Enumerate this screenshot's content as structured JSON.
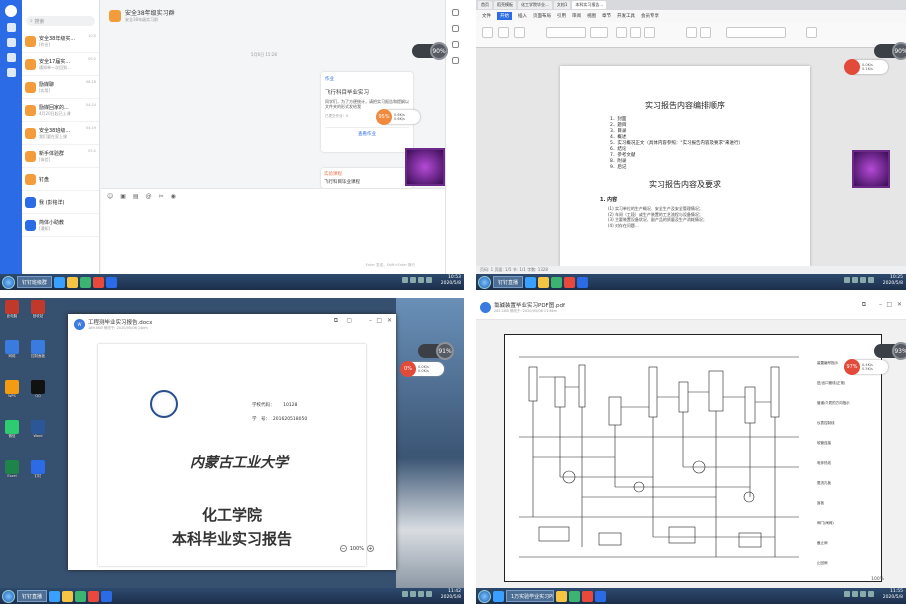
{
  "q1": {
    "search_placeholder": "搜索",
    "chat_title": "安全38年级实习群",
    "chat_subtitle": "安全38年级实习群",
    "timestamp_center": "5月6日 15:28",
    "conversations": [
      {
        "name": "安全38年级实...",
        "preview": "[作业]",
        "time": "10:5"
      },
      {
        "name": "安全17届实...",
        "preview": "通知单一次回到...",
        "time": "05:2"
      },
      {
        "name": "励媒聊",
        "preview": "[实用]",
        "time": "06:18"
      },
      {
        "name": "励媒回家的...",
        "preview": "4月20日起已上课",
        "time": "04:24"
      },
      {
        "name": "安全38班级...",
        "preview": "我们要在家上课",
        "time": "04:19"
      },
      {
        "name": "新手体验群",
        "preview": "[体验]",
        "time": "05:2"
      },
      {
        "name": "钉盘",
        "preview": "",
        "time": ""
      },
      {
        "name": "我 (彭铭洋)",
        "preview": "",
        "time": ""
      },
      {
        "name": "简体小助教",
        "preview": "[通知]",
        "time": ""
      }
    ],
    "homework_card": {
      "tag": "作业",
      "title": "飞行科目毕业实习",
      "body": "同学们，为了方便统计，请把实习报告和提纲以文件夹的形式发给我",
      "meta": "已提交作业：0",
      "action": "查看作业"
    },
    "second_card_tag": "实验课程",
    "second_card_title": "飞行科目毕业课程",
    "input_hint": "Enter 发送，Shift+Enter 换行",
    "gauge": "90%",
    "speed": {
      "value": "95%",
      "up": "0.6K/s",
      "down": "0.6K/s"
    },
    "taskbar_task": "钉钉班级群",
    "clock": {
      "time": "10:53",
      "date": "2020/5/8"
    }
  },
  "q2": {
    "tabs": [
      "首页",
      "稻壳模板",
      "化工学院毕业...",
      "文档1",
      "本科实习报告..."
    ],
    "menus": [
      "文件",
      "开始",
      "插入",
      "页面布局",
      "引用",
      "审阅",
      "视图",
      "章节",
      "开发工具",
      "会员专享"
    ],
    "doc": {
      "title": "实习报告内容编排顺序",
      "items": [
        "封面",
        "题目",
        "目录",
        "概述",
        "实习概况正文（具体内容参照：\"实习报告内容及要求\"来进行）",
        "结论",
        "参考文献",
        "附录",
        "后记"
      ],
      "subtitle": "实习报告内容及要求",
      "section": "1. 内容",
      "paras": [
        "(1) 实习单位的生产概况、安全生产及安全管理情况；",
        "(2) 车间（工段）或生产装置的工艺流程与设备情况；",
        "(3) 主要装置设备状况、副产品的质量及生产消耗情况；",
        "(4) 对存在问题..."
      ]
    },
    "status": "页码: 1  页面: 1/5  节: 1/1  字数: 1328",
    "gauge": "90%",
    "speed": {
      "value": "",
      "up": "0.0K/s",
      "down": "0.1K/s"
    },
    "taskbar_task": "钉钉直播",
    "clock": {
      "time": "10:25",
      "date": "2020/5/8"
    }
  },
  "q3": {
    "window_title": "工程测毕业实习报告.docx",
    "window_meta": "189.0KB  修改于: 2020/05/06 14km",
    "school_code_label": "学校代码：",
    "school_code": "10128",
    "student_id_label": "学　号：",
    "student_id": "201620518050",
    "university": "内蒙古工业大学",
    "college": "化工学院",
    "report_title": "本科毕业实习报告",
    "zoom": "100%",
    "gauge": "91%",
    "speed": {
      "value": "0%",
      "up": "0.0K/s",
      "down": "0.0K/s"
    },
    "desktop_icons": [
      "此电脑",
      "回收站",
      "网络",
      "控制面板",
      "WPS",
      "QQ",
      "微信",
      "Word",
      "Excel",
      "钉钉"
    ],
    "taskbar_task": "钉钉直播",
    "clock": {
      "time": "11:42",
      "date": "2020/5/8"
    }
  },
  "q4": {
    "file_title": "氯碱装置毕业实习PDF图.pdf",
    "file_meta": "281.1KB  修改于: 2020/05/06 11:8km",
    "zoom": "100%",
    "gauge": "93%",
    "speed": {
      "value": "97%",
      "up": "0.4K/s",
      "down": "0.5K/s"
    },
    "legend": [
      "装置编号指示",
      "进/出口管线(正常)",
      "管道/介质的方向指示",
      "仪表控制线",
      "软管连接",
      "电伴热线",
      "限流孔板",
      "盲板",
      "阀门(闸阀)",
      "截止阀",
      "止回阀"
    ],
    "taskbar_task": "1万实验毕业实习PD...",
    "clock": {
      "time": "11:55",
      "date": "2020/5/8"
    }
  }
}
